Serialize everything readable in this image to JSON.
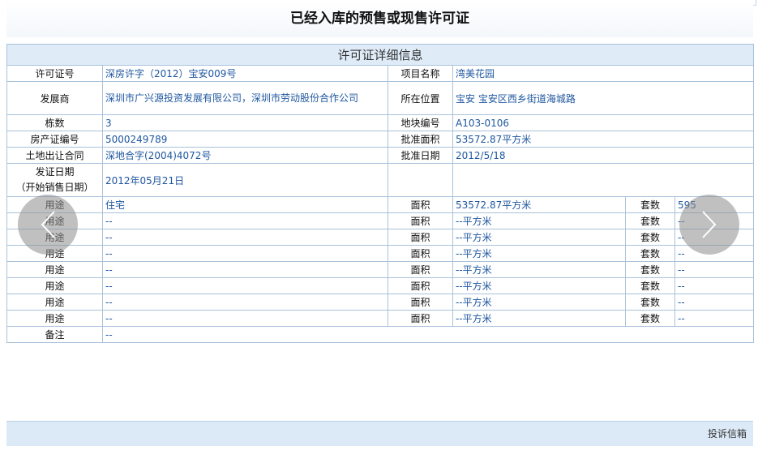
{
  "page": {
    "title": "已经入库的预售或现售许可证",
    "footer_link": "投诉信箱"
  },
  "table": {
    "header": "许可证详细信息",
    "labels": {
      "permit_no": "许可证号",
      "project_name": "项目名称",
      "developer": "发展商",
      "location": "所在位置",
      "buildings": "栋数",
      "plot_no": "地块编号",
      "cert_no": "房产证编号",
      "approved_area": "批准面积",
      "land_contract": "土地出让合同",
      "approval_date": "批准日期",
      "issue_date_line1": "发证日期",
      "issue_date_line2": "（开始销售日期）",
      "usage": "用途",
      "area": "面积",
      "units": "套数",
      "remark": "备注"
    },
    "values": {
      "permit_no": "深房许字（2012）宝安009号",
      "project_name": "湾美花园",
      "developer": "深圳市广兴源投资发展有限公司，深圳市劳动股份合作公司",
      "location": "宝安 宝安区西乡街道海城路",
      "buildings": "3",
      "plot_no": "A103-0106",
      "cert_no": "5000249789",
      "approved_area": "53572.87平方米",
      "land_contract": "深地合字(2004)4072号",
      "approval_date": "2012/5/18",
      "issue_date": "2012年05月21日",
      "remark": "--"
    },
    "usage_rows": [
      {
        "usage": "住宅",
        "area": "53572.87平方米",
        "units": "595"
      },
      {
        "usage": "--",
        "area": "--平方米",
        "units": "--"
      },
      {
        "usage": "--",
        "area": "--平方米",
        "units": "--"
      },
      {
        "usage": "--",
        "area": "--平方米",
        "units": "--"
      },
      {
        "usage": "--",
        "area": "--平方米",
        "units": "--"
      },
      {
        "usage": "--",
        "area": "--平方米",
        "units": "--"
      },
      {
        "usage": "--",
        "area": "--平方米",
        "units": "--"
      },
      {
        "usage": "--",
        "area": "--平方米",
        "units": "--"
      }
    ]
  },
  "icons": {
    "prev": "chevron-left-icon",
    "next": "chevron-right-icon"
  },
  "colors": {
    "link_blue": "#1f57a0",
    "header_bg": "#dfecf8",
    "border": "#a9c1da"
  }
}
